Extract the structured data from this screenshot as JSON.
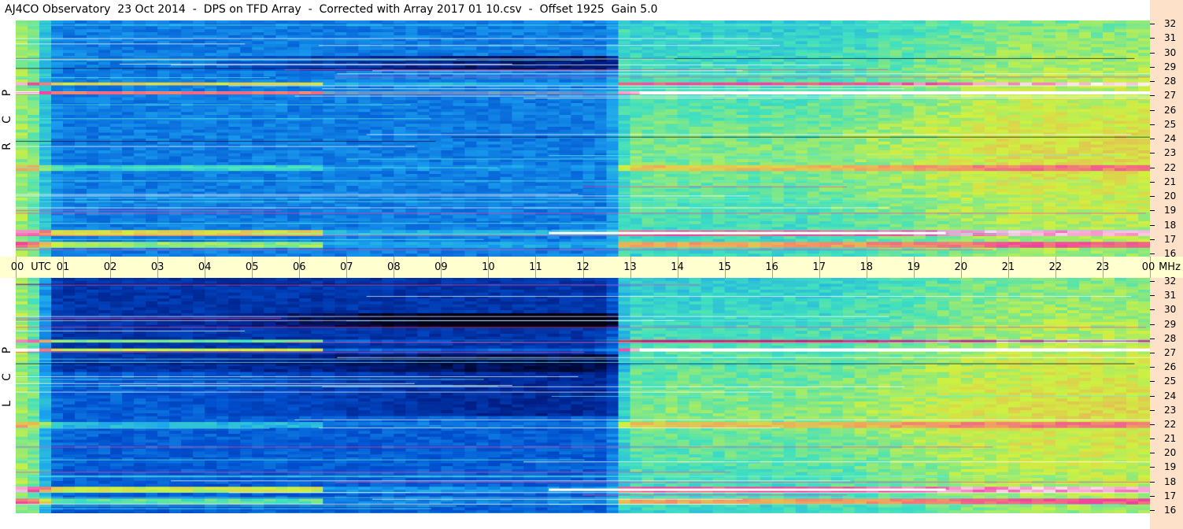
{
  "title": "AJ4CO Observatory  23 Oct 2014  -  DPS on TFD Array  -  Corrected with Array 2017 01 10.csv  -  Offset 1925  Gain 5.0",
  "chart_data": {
    "type": "heatmap",
    "panels": [
      {
        "name": "RCP",
        "label_letters": [
          "R",
          "C",
          "P"
        ]
      },
      {
        "name": "LCP",
        "label_letters": [
          "L",
          "C",
          "P"
        ]
      }
    ],
    "x_ticks": [
      "00",
      "01",
      "02",
      "03",
      "04",
      "05",
      "06",
      "07",
      "08",
      "09",
      "10",
      "11",
      "12",
      "13",
      "14",
      "15",
      "16",
      "17",
      "18",
      "19",
      "20",
      "21",
      "22",
      "23",
      "00"
    ],
    "x_unit_label": "UTC",
    "y_unit_label": "MHz",
    "y_ticks": [
      16,
      17,
      18,
      19,
      20,
      21,
      22,
      23,
      24,
      25,
      26,
      27,
      28,
      29,
      30,
      31,
      32
    ],
    "ylim": [
      16,
      32
    ],
    "xlim_hours": [
      0,
      24
    ],
    "colormap": [
      "#000018",
      "#00208a",
      "#0050d0",
      "#1aa0f0",
      "#40e0c0",
      "#d0f040",
      "#f0a060",
      "#f040a0",
      "#ffffff"
    ]
  }
}
